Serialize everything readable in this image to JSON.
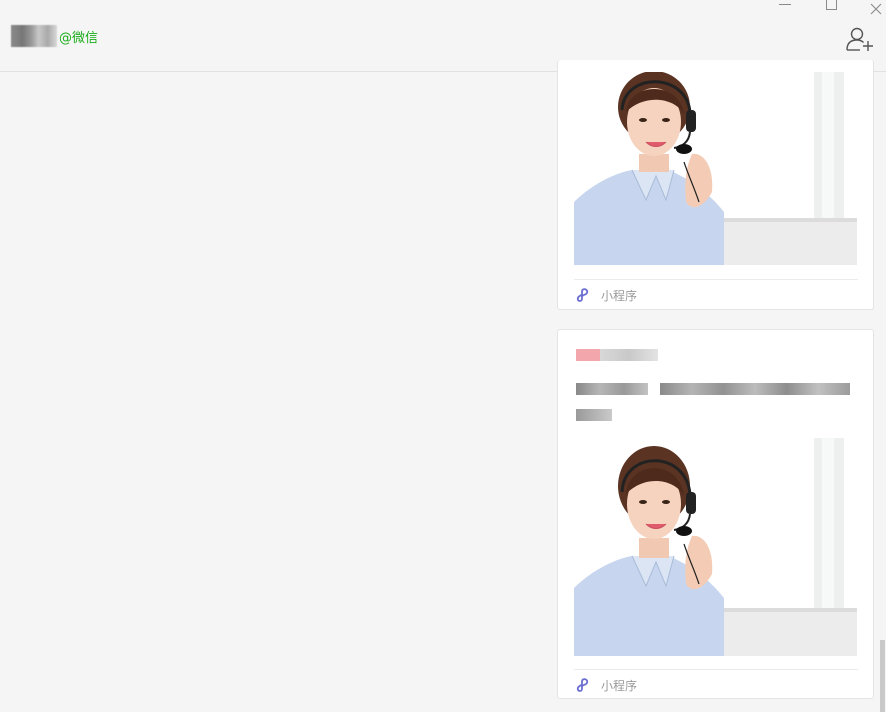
{
  "header": {
    "chat_tag": "@微信",
    "add_member_icon": "add-member-icon"
  },
  "window": {
    "controls": [
      "minimize-icon",
      "maximize-icon",
      "close-icon"
    ]
  },
  "messages": [
    {
      "type": "mini-program",
      "footer_label": "小程序",
      "image": "customer-service-agent-photo"
    },
    {
      "type": "mini-program",
      "footer_label": "小程序",
      "image": "customer-service-agent-photo"
    }
  ],
  "colors": {
    "accent": "#1aad19",
    "mini_program_icon": "#6b6fd1",
    "background": "#f5f5f5"
  }
}
